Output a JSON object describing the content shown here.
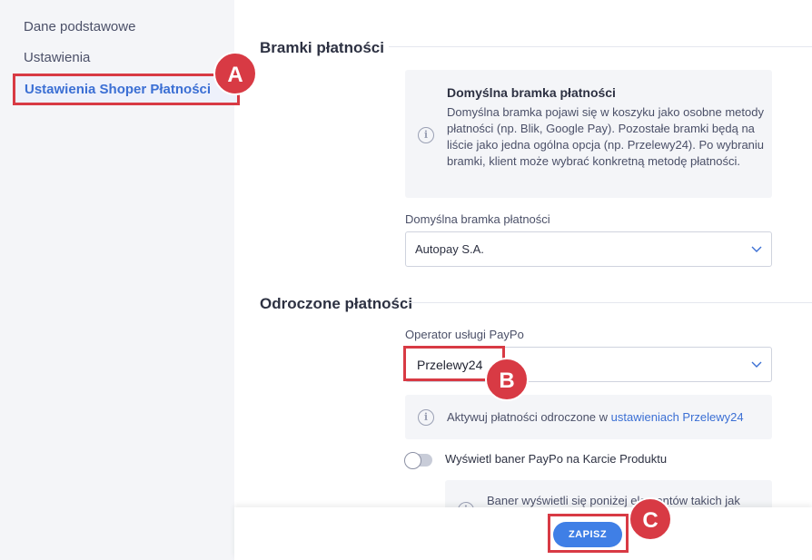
{
  "sidebar": {
    "items": [
      {
        "label": "Dane podstawowe"
      },
      {
        "label": "Ustawienia"
      },
      {
        "label": "Ustawienia Shoper Płatności"
      }
    ]
  },
  "gateways": {
    "title": "Bramki płatności",
    "info_title": "Domyślna bramka płatności",
    "info_desc": "Domyślna bramka pojawi się w koszyku jako osobne metody płatności (np. Blik, Google Pay). Pozostałe bramki będą na liście jako jedna ogólna opcja (np. Przelewy24). Po wybraniu bramki, klient może wybrać konkretną metodę płatności.",
    "field_label": "Domyślna bramka płatności",
    "selected": "Autopay S.A."
  },
  "deferred": {
    "title": "Odroczone płatności",
    "field_label": "Operator usługi PayPo",
    "selected": "Przelewy24",
    "info_text": "Aktywuj płatności odroczone w ",
    "info_link": "ustawieniach Przelewy24",
    "toggle_label": "Wyświetl baner PayPo na Karcie Produktu",
    "banner_info_partial": "Baner wyświetli się poniżej elementów takich jak"
  },
  "footer": {
    "save_label": "ZAPISZ"
  },
  "badges": {
    "a": "A",
    "b": "B",
    "c": "C"
  },
  "colors": {
    "accent": "#3f7fe6",
    "highlight": "#d83a44",
    "link": "#3b6fd4"
  }
}
